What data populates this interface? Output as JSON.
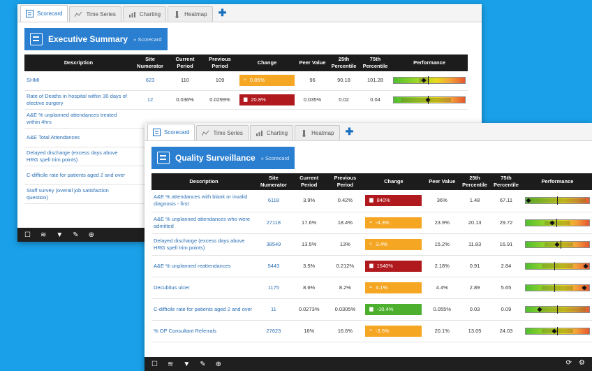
{
  "tabs": [
    "Scorecard",
    "Time Series",
    "Charting",
    "Heatmap"
  ],
  "headers": [
    "Description",
    "Site Numerator",
    "Current Period",
    "Previous Period",
    "Change",
    "Peer Value",
    "25th Percentile",
    "75th Percentile",
    "Performance"
  ],
  "icons": {
    "scorecard": "scorecard-icon",
    "timeseries": "time-series-icon",
    "charting": "charting-icon",
    "heatmap": "heatmap-icon",
    "add": "plus-icon",
    "footer": [
      "square-icon",
      "layers-icon",
      "filter-icon",
      "wrench-icon",
      "download-icon"
    ],
    "footer_right": [
      "refresh-icon",
      "settings-icon"
    ]
  },
  "colors": {
    "background": "#1aa0e8",
    "title_blue": "#2b7fd0",
    "orange": "#f5a623",
    "red": "#b0191e",
    "green": "#4caf2d"
  },
  "win1": {
    "title": "Executive Summary",
    "subtitle": "» Scorecard",
    "rows": [
      {
        "description": "SHMI",
        "numerator": "623",
        "current": "110",
        "previous": "109",
        "change": "0.85%",
        "change_color": "orange",
        "change_icon": "≈",
        "peer": "96",
        "p25": "90.18",
        "p75": "101.28",
        "perf": {
          "marker": 0.42,
          "band": [
            0.35,
            0.5
          ],
          "tick": 0.48
        }
      },
      {
        "description": "Rate of Deaths in hospital within 30 days of elective surgery",
        "numerator": "12",
        "current": "0.036%",
        "previous": "0.0299%",
        "change": "20.8%",
        "change_color": "red",
        "change_icon": "▆",
        "peer": "0.035%",
        "p25": "0.02",
        "p75": "0.04",
        "perf": {
          "marker": 0.48,
          "band": [
            0.1,
            0.8
          ],
          "tick": 0.48
        }
      },
      {
        "description": "A&E % unplanned attendances treated within 4hrs",
        "numerator": "",
        "current": "",
        "previous": "",
        "change": "",
        "change_color": "",
        "change_icon": "",
        "peer": "",
        "p25": "",
        "p75": "",
        "perf": null
      },
      {
        "description": "A&E Total Attendances",
        "numerator": "",
        "current": "",
        "previous": "",
        "change": "",
        "change_color": "",
        "change_icon": "",
        "peer": "",
        "p25": "",
        "p75": "",
        "perf": null
      },
      {
        "description": "Delayed discharge (excess days above HRG spell trim points)",
        "numerator": "",
        "current": "",
        "previous": "",
        "change": "",
        "change_color": "",
        "change_icon": "",
        "peer": "",
        "p25": "",
        "p75": "",
        "perf": null
      },
      {
        "description": "C-difficile rate for patients aged 2 and over",
        "numerator": "",
        "current": "",
        "previous": "",
        "change": "",
        "change_color": "",
        "change_icon": "",
        "peer": "",
        "p25": "",
        "p75": "",
        "perf": null
      },
      {
        "description": "Staff survey (overall job satisfaction question)",
        "numerator": "",
        "current": "",
        "previous": "",
        "change": "",
        "change_color": "",
        "change_icon": "",
        "peer": "",
        "p25": "",
        "p75": "",
        "perf": null
      }
    ]
  },
  "win2": {
    "title": "Quality Surveillance",
    "subtitle": "» Scorecard",
    "rows": [
      {
        "description": "A&E % attendances with blank or invalid diagnosis - first",
        "numerator": "6118",
        "current": "3.9%",
        "previous": "0.42%",
        "change": "840%",
        "change_color": "red",
        "change_icon": "▆",
        "peer": "36%",
        "p25": "1.48",
        "p75": "67.11",
        "perf": {
          "marker": 0.05,
          "band": [
            0.05,
            0.95
          ],
          "tick": 0.5
        }
      },
      {
        "description": "A&E % unplanned attendances who were admitted",
        "numerator": "27118",
        "current": "17.6%",
        "previous": "18.4%",
        "change": "-4.3%",
        "change_color": "orange",
        "change_icon": "≈",
        "peer": "23.9%",
        "p25": "20.13",
        "p75": "29.72",
        "perf": {
          "marker": 0.42,
          "band": [
            0.3,
            0.7
          ],
          "tick": 0.48
        }
      },
      {
        "description": "Delayed discharge (excess days above HRG spell trim points)",
        "numerator": "38549",
        "current": "13.5%",
        "previous": "13%",
        "change": "3.4%",
        "change_color": "orange",
        "change_icon": "≈",
        "peer": "15.2%",
        "p25": "11.83",
        "p75": "16.91",
        "perf": {
          "marker": 0.5,
          "band": [
            0.3,
            0.75
          ],
          "tick": 0.55
        }
      },
      {
        "description": "A&E % unplanned reattendances",
        "numerator": "5443",
        "current": "3.5%",
        "previous": "0.212%",
        "change": "1540%",
        "change_color": "red",
        "change_icon": "▆",
        "peer": "2.18%",
        "p25": "0.91",
        "p75": "2.84",
        "perf": {
          "marker": 0.95,
          "band": [
            0.25,
            0.75
          ],
          "tick": 0.45
        }
      },
      {
        "description": "Decubitus ulcer",
        "numerator": "1175",
        "current": "8.6%",
        "previous": "8.2%",
        "change": "4.1%",
        "change_color": "orange",
        "change_icon": "≈",
        "peer": "4.4%",
        "p25": "2.89",
        "p75": "5.65",
        "perf": {
          "marker": 0.92,
          "band": [
            0.25,
            0.75
          ],
          "tick": 0.45
        }
      },
      {
        "description": "C-difficile rate for patients aged 2 and over",
        "numerator": "11",
        "current": "0.0273%",
        "previous": "0.0305%",
        "change": "-10.4%",
        "change_color": "green",
        "change_icon": "▆",
        "peer": "0.055%",
        "p25": "0.03",
        "p75": "0.09",
        "perf": {
          "marker": 0.22,
          "band": [
            0.2,
            0.95
          ],
          "tick": 0.5
        }
      },
      {
        "description": "% OP Consultant Referrals",
        "numerator": "27623",
        "current": "16%",
        "previous": "16.6%",
        "change": "-3.5%",
        "change_color": "orange",
        "change_icon": "≈",
        "peer": "20.1%",
        "p25": "13.05",
        "p75": "24.03",
        "perf": {
          "marker": 0.45,
          "band": [
            0.25,
            0.75
          ],
          "tick": 0.5
        }
      }
    ]
  }
}
